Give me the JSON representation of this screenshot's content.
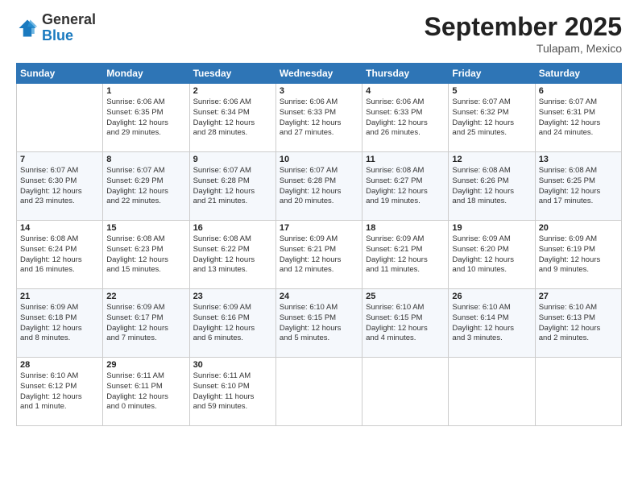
{
  "header": {
    "logo_general": "General",
    "logo_blue": "Blue",
    "month": "September 2025",
    "location": "Tulapam, Mexico"
  },
  "days_of_week": [
    "Sunday",
    "Monday",
    "Tuesday",
    "Wednesday",
    "Thursday",
    "Friday",
    "Saturday"
  ],
  "weeks": [
    [
      {
        "day": "",
        "info": ""
      },
      {
        "day": "1",
        "info": "Sunrise: 6:06 AM\nSunset: 6:35 PM\nDaylight: 12 hours\nand 29 minutes."
      },
      {
        "day": "2",
        "info": "Sunrise: 6:06 AM\nSunset: 6:34 PM\nDaylight: 12 hours\nand 28 minutes."
      },
      {
        "day": "3",
        "info": "Sunrise: 6:06 AM\nSunset: 6:33 PM\nDaylight: 12 hours\nand 27 minutes."
      },
      {
        "day": "4",
        "info": "Sunrise: 6:06 AM\nSunset: 6:33 PM\nDaylight: 12 hours\nand 26 minutes."
      },
      {
        "day": "5",
        "info": "Sunrise: 6:07 AM\nSunset: 6:32 PM\nDaylight: 12 hours\nand 25 minutes."
      },
      {
        "day": "6",
        "info": "Sunrise: 6:07 AM\nSunset: 6:31 PM\nDaylight: 12 hours\nand 24 minutes."
      }
    ],
    [
      {
        "day": "7",
        "info": "Sunrise: 6:07 AM\nSunset: 6:30 PM\nDaylight: 12 hours\nand 23 minutes."
      },
      {
        "day": "8",
        "info": "Sunrise: 6:07 AM\nSunset: 6:29 PM\nDaylight: 12 hours\nand 22 minutes."
      },
      {
        "day": "9",
        "info": "Sunrise: 6:07 AM\nSunset: 6:28 PM\nDaylight: 12 hours\nand 21 minutes."
      },
      {
        "day": "10",
        "info": "Sunrise: 6:07 AM\nSunset: 6:28 PM\nDaylight: 12 hours\nand 20 minutes."
      },
      {
        "day": "11",
        "info": "Sunrise: 6:08 AM\nSunset: 6:27 PM\nDaylight: 12 hours\nand 19 minutes."
      },
      {
        "day": "12",
        "info": "Sunrise: 6:08 AM\nSunset: 6:26 PM\nDaylight: 12 hours\nand 18 minutes."
      },
      {
        "day": "13",
        "info": "Sunrise: 6:08 AM\nSunset: 6:25 PM\nDaylight: 12 hours\nand 17 minutes."
      }
    ],
    [
      {
        "day": "14",
        "info": "Sunrise: 6:08 AM\nSunset: 6:24 PM\nDaylight: 12 hours\nand 16 minutes."
      },
      {
        "day": "15",
        "info": "Sunrise: 6:08 AM\nSunset: 6:23 PM\nDaylight: 12 hours\nand 15 minutes."
      },
      {
        "day": "16",
        "info": "Sunrise: 6:08 AM\nSunset: 6:22 PM\nDaylight: 12 hours\nand 13 minutes."
      },
      {
        "day": "17",
        "info": "Sunrise: 6:09 AM\nSunset: 6:21 PM\nDaylight: 12 hours\nand 12 minutes."
      },
      {
        "day": "18",
        "info": "Sunrise: 6:09 AM\nSunset: 6:21 PM\nDaylight: 12 hours\nand 11 minutes."
      },
      {
        "day": "19",
        "info": "Sunrise: 6:09 AM\nSunset: 6:20 PM\nDaylight: 12 hours\nand 10 minutes."
      },
      {
        "day": "20",
        "info": "Sunrise: 6:09 AM\nSunset: 6:19 PM\nDaylight: 12 hours\nand 9 minutes."
      }
    ],
    [
      {
        "day": "21",
        "info": "Sunrise: 6:09 AM\nSunset: 6:18 PM\nDaylight: 12 hours\nand 8 minutes."
      },
      {
        "day": "22",
        "info": "Sunrise: 6:09 AM\nSunset: 6:17 PM\nDaylight: 12 hours\nand 7 minutes."
      },
      {
        "day": "23",
        "info": "Sunrise: 6:09 AM\nSunset: 6:16 PM\nDaylight: 12 hours\nand 6 minutes."
      },
      {
        "day": "24",
        "info": "Sunrise: 6:10 AM\nSunset: 6:15 PM\nDaylight: 12 hours\nand 5 minutes."
      },
      {
        "day": "25",
        "info": "Sunrise: 6:10 AM\nSunset: 6:15 PM\nDaylight: 12 hours\nand 4 minutes."
      },
      {
        "day": "26",
        "info": "Sunrise: 6:10 AM\nSunset: 6:14 PM\nDaylight: 12 hours\nand 3 minutes."
      },
      {
        "day": "27",
        "info": "Sunrise: 6:10 AM\nSunset: 6:13 PM\nDaylight: 12 hours\nand 2 minutes."
      }
    ],
    [
      {
        "day": "28",
        "info": "Sunrise: 6:10 AM\nSunset: 6:12 PM\nDaylight: 12 hours\nand 1 minute."
      },
      {
        "day": "29",
        "info": "Sunrise: 6:11 AM\nSunset: 6:11 PM\nDaylight: 12 hours\nand 0 minutes."
      },
      {
        "day": "30",
        "info": "Sunrise: 6:11 AM\nSunset: 6:10 PM\nDaylight: 11 hours\nand 59 minutes."
      },
      {
        "day": "",
        "info": ""
      },
      {
        "day": "",
        "info": ""
      },
      {
        "day": "",
        "info": ""
      },
      {
        "day": "",
        "info": ""
      }
    ]
  ]
}
